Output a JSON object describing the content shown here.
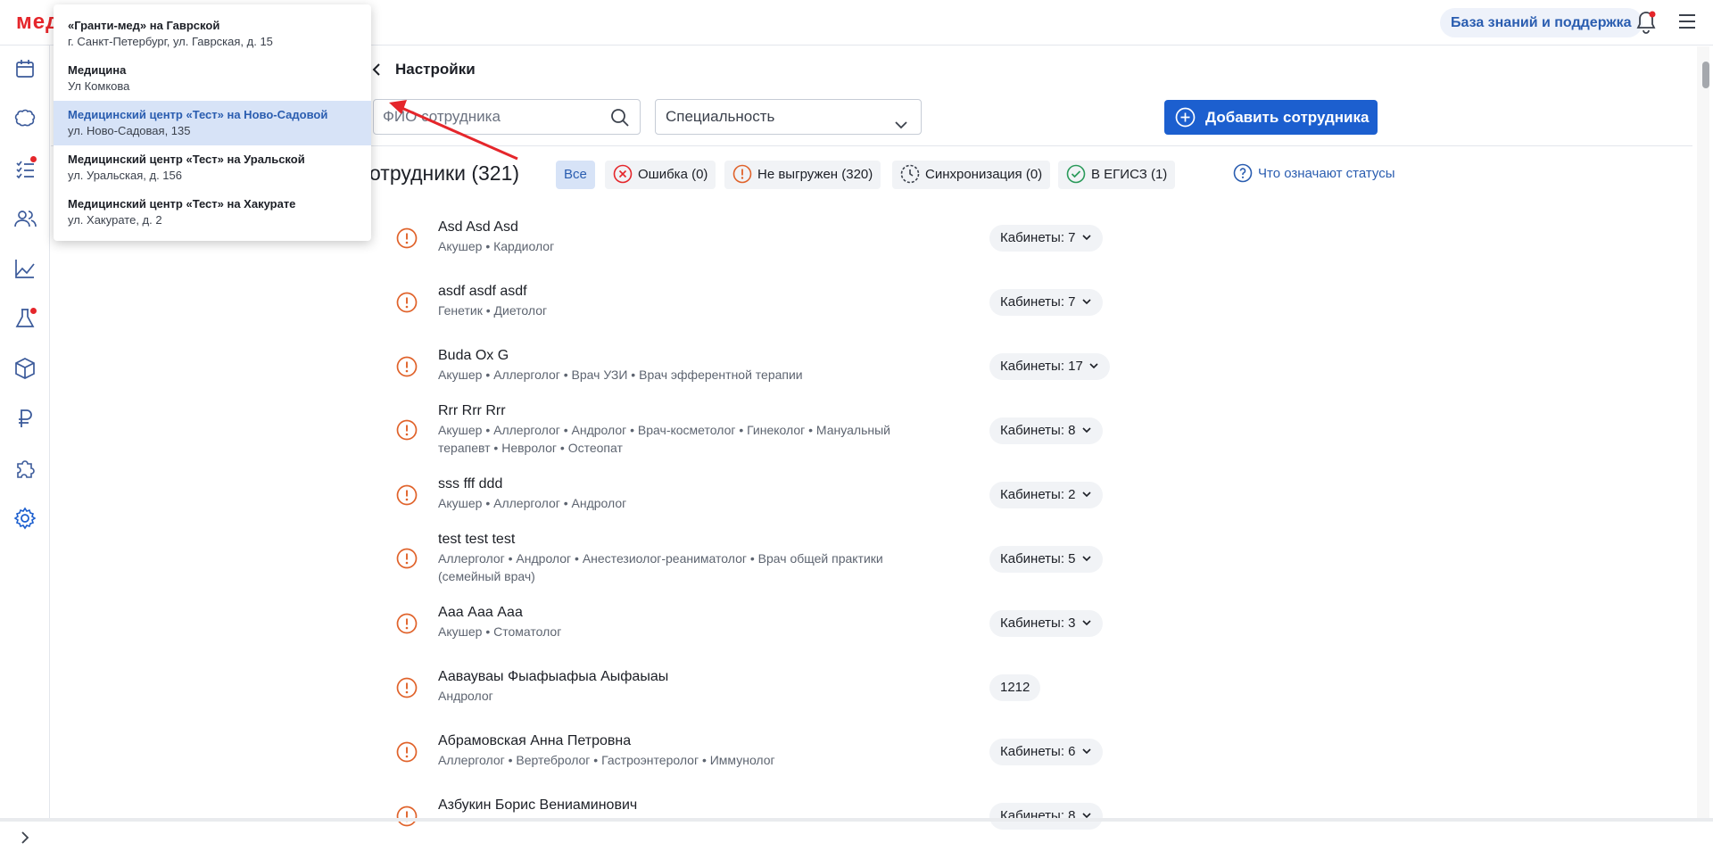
{
  "header": {
    "logo": "мед",
    "help_button": "База знаний и поддержка"
  },
  "sidebar": {
    "items": [
      {
        "icon": "calendar-icon"
      },
      {
        "icon": "brain-icon"
      },
      {
        "icon": "checklist-icon",
        "badge": true
      },
      {
        "icon": "users-icon"
      },
      {
        "icon": "chart-icon"
      },
      {
        "icon": "flask-icon",
        "badge": true
      },
      {
        "icon": "box-icon"
      },
      {
        "icon": "ruble-icon"
      },
      {
        "icon": "puzzle-icon"
      },
      {
        "icon": "gear-icon",
        "active": true
      }
    ]
  },
  "clinic_dropdown": {
    "items": [
      {
        "title": "«Гранти-мед» на Гаврской",
        "address": "г. Санкт-Петербург, ул. Гаврская, д. 15",
        "selected": false
      },
      {
        "title": "Медицина",
        "address": "Ул Комкова",
        "selected": false
      },
      {
        "title": "Медицинский центр «Тест» на Ново-Садовой",
        "address": "ул. Ново-Садовая, 135",
        "selected": true
      },
      {
        "title": "Медицинский центр «Тест» на Уральской",
        "address": "ул. Уральская, д. 156",
        "selected": false
      },
      {
        "title": "Медицинский центр «Тест» на Хакурате",
        "address": "ул. Хакурате, д. 2",
        "selected": false
      }
    ]
  },
  "page": {
    "breadcrumb": "Настройки",
    "search_placeholder": "ФИО сотрудника",
    "specialty_select": "Специальность",
    "add_button": "Добавить сотрудника",
    "section_title": "отрудники (321)",
    "status_help": "Что означают статусы"
  },
  "filters": [
    {
      "label": "Все",
      "active": true,
      "icon": ""
    },
    {
      "label": "Ошибка (0)",
      "active": false,
      "icon": "error-icon"
    },
    {
      "label": "Не выгружен (320)",
      "active": false,
      "icon": "warning-icon"
    },
    {
      "label": "Синхронизация (0)",
      "active": false,
      "icon": "sync-icon"
    },
    {
      "label": "В ЕГИСЗ (1)",
      "active": false,
      "icon": "check-icon"
    }
  ],
  "employees": [
    {
      "name": "Asd Asd Asd",
      "specs": "Акушер • Кардиолог",
      "cabinets": "Кабинеты: 7",
      "has_dropdown": true
    },
    {
      "name": "asdf asdf asdf",
      "specs": "Генетик • Диетолог",
      "cabinets": "Кабинеты: 7",
      "has_dropdown": true
    },
    {
      "name": "Buda Ox G",
      "specs": "Акушер • Аллерголог • Врач УЗИ • Врач эфферентной терапии",
      "cabinets": "Кабинеты: 17",
      "has_dropdown": true
    },
    {
      "name": "Rrr Rrr Rrr",
      "specs": "Акушер • Аллерголог • Андролог • Врач-косметолог • Гинеколог • Мануальный терапевт • Невролог • Остеопат",
      "cabinets": "Кабинеты: 8",
      "has_dropdown": true
    },
    {
      "name": "sss fff ddd",
      "specs": "Акушер • Аллерголог • Андролог",
      "cabinets": "Кабинеты: 2",
      "has_dropdown": true
    },
    {
      "name": "test test test",
      "specs": "Аллерголог • Андролог • Анестезиолог-реаниматолог • Врач общей практики (семейный врач)",
      "cabinets": "Кабинеты: 5",
      "has_dropdown": true
    },
    {
      "name": "Ааа Ааа Ааа",
      "specs": "Акушер • Стоматолог",
      "cabinets": "Кабинеты: 3",
      "has_dropdown": true
    },
    {
      "name": "Аавауваы Фыафыафыа Аыфаыаы",
      "specs": "Андролог",
      "cabinets": "1212",
      "has_dropdown": false
    },
    {
      "name": "Абрамовская Анна Петровна",
      "specs": "Аллерголог • Вертебролог • Гастроэнтеролог • Иммунолог",
      "cabinets": "Кабинеты: 6",
      "has_dropdown": true
    },
    {
      "name": "Азбукин Борис Вениаминович",
      "specs": "",
      "cabinets": "Кабинеты: 8",
      "has_dropdown": true
    }
  ],
  "colors": {
    "accent": "#1c5fcf",
    "warning": "#e0622a",
    "error": "#e5262b",
    "success": "#2a9a5a"
  }
}
